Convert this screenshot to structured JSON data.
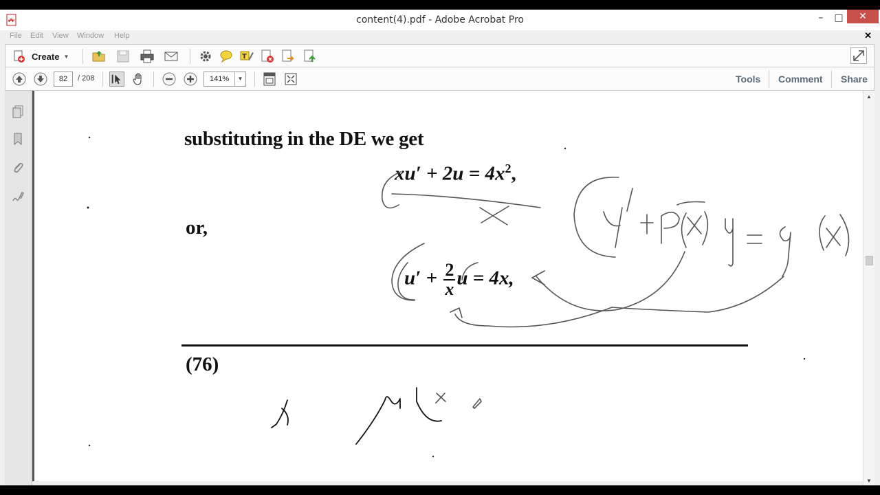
{
  "window": {
    "title": "content(4).pdf - Adobe Acrobat Pro",
    "controls": {
      "minimize": "–",
      "maximize": "□",
      "close": "✕"
    }
  },
  "menu": {
    "items": [
      "File",
      "Edit",
      "View",
      "Window",
      "Help"
    ],
    "doc_close": "✕"
  },
  "toolbar": {
    "create_label": "Create",
    "icons": [
      "open-folder-icon",
      "save-icon",
      "print-icon",
      "email-icon",
      "gear-icon",
      "comment-bubble-icon",
      "highlight-icon",
      "delete-icon",
      "export-icon",
      "share-icon"
    ]
  },
  "navigation": {
    "current_page": "82",
    "total_pages": "/  208",
    "zoom": "141%",
    "tabs": [
      "Tools",
      "Comment",
      "Share"
    ]
  },
  "document": {
    "line1": "substituting in the DE we get",
    "eq1_main": "xu′ + 2u = 4x",
    "eq1_exp": "2",
    "eq1_tail": ",",
    "or_label": "or,",
    "eq2_left": "u′ + ",
    "eq2_num": "2",
    "eq2_den": "x",
    "eq2_right": "u = 4x,",
    "page_number": "(76)"
  },
  "colors": {
    "close_button": "#c7504a",
    "tab_text": "#5a6a77",
    "ink": "#555555"
  }
}
